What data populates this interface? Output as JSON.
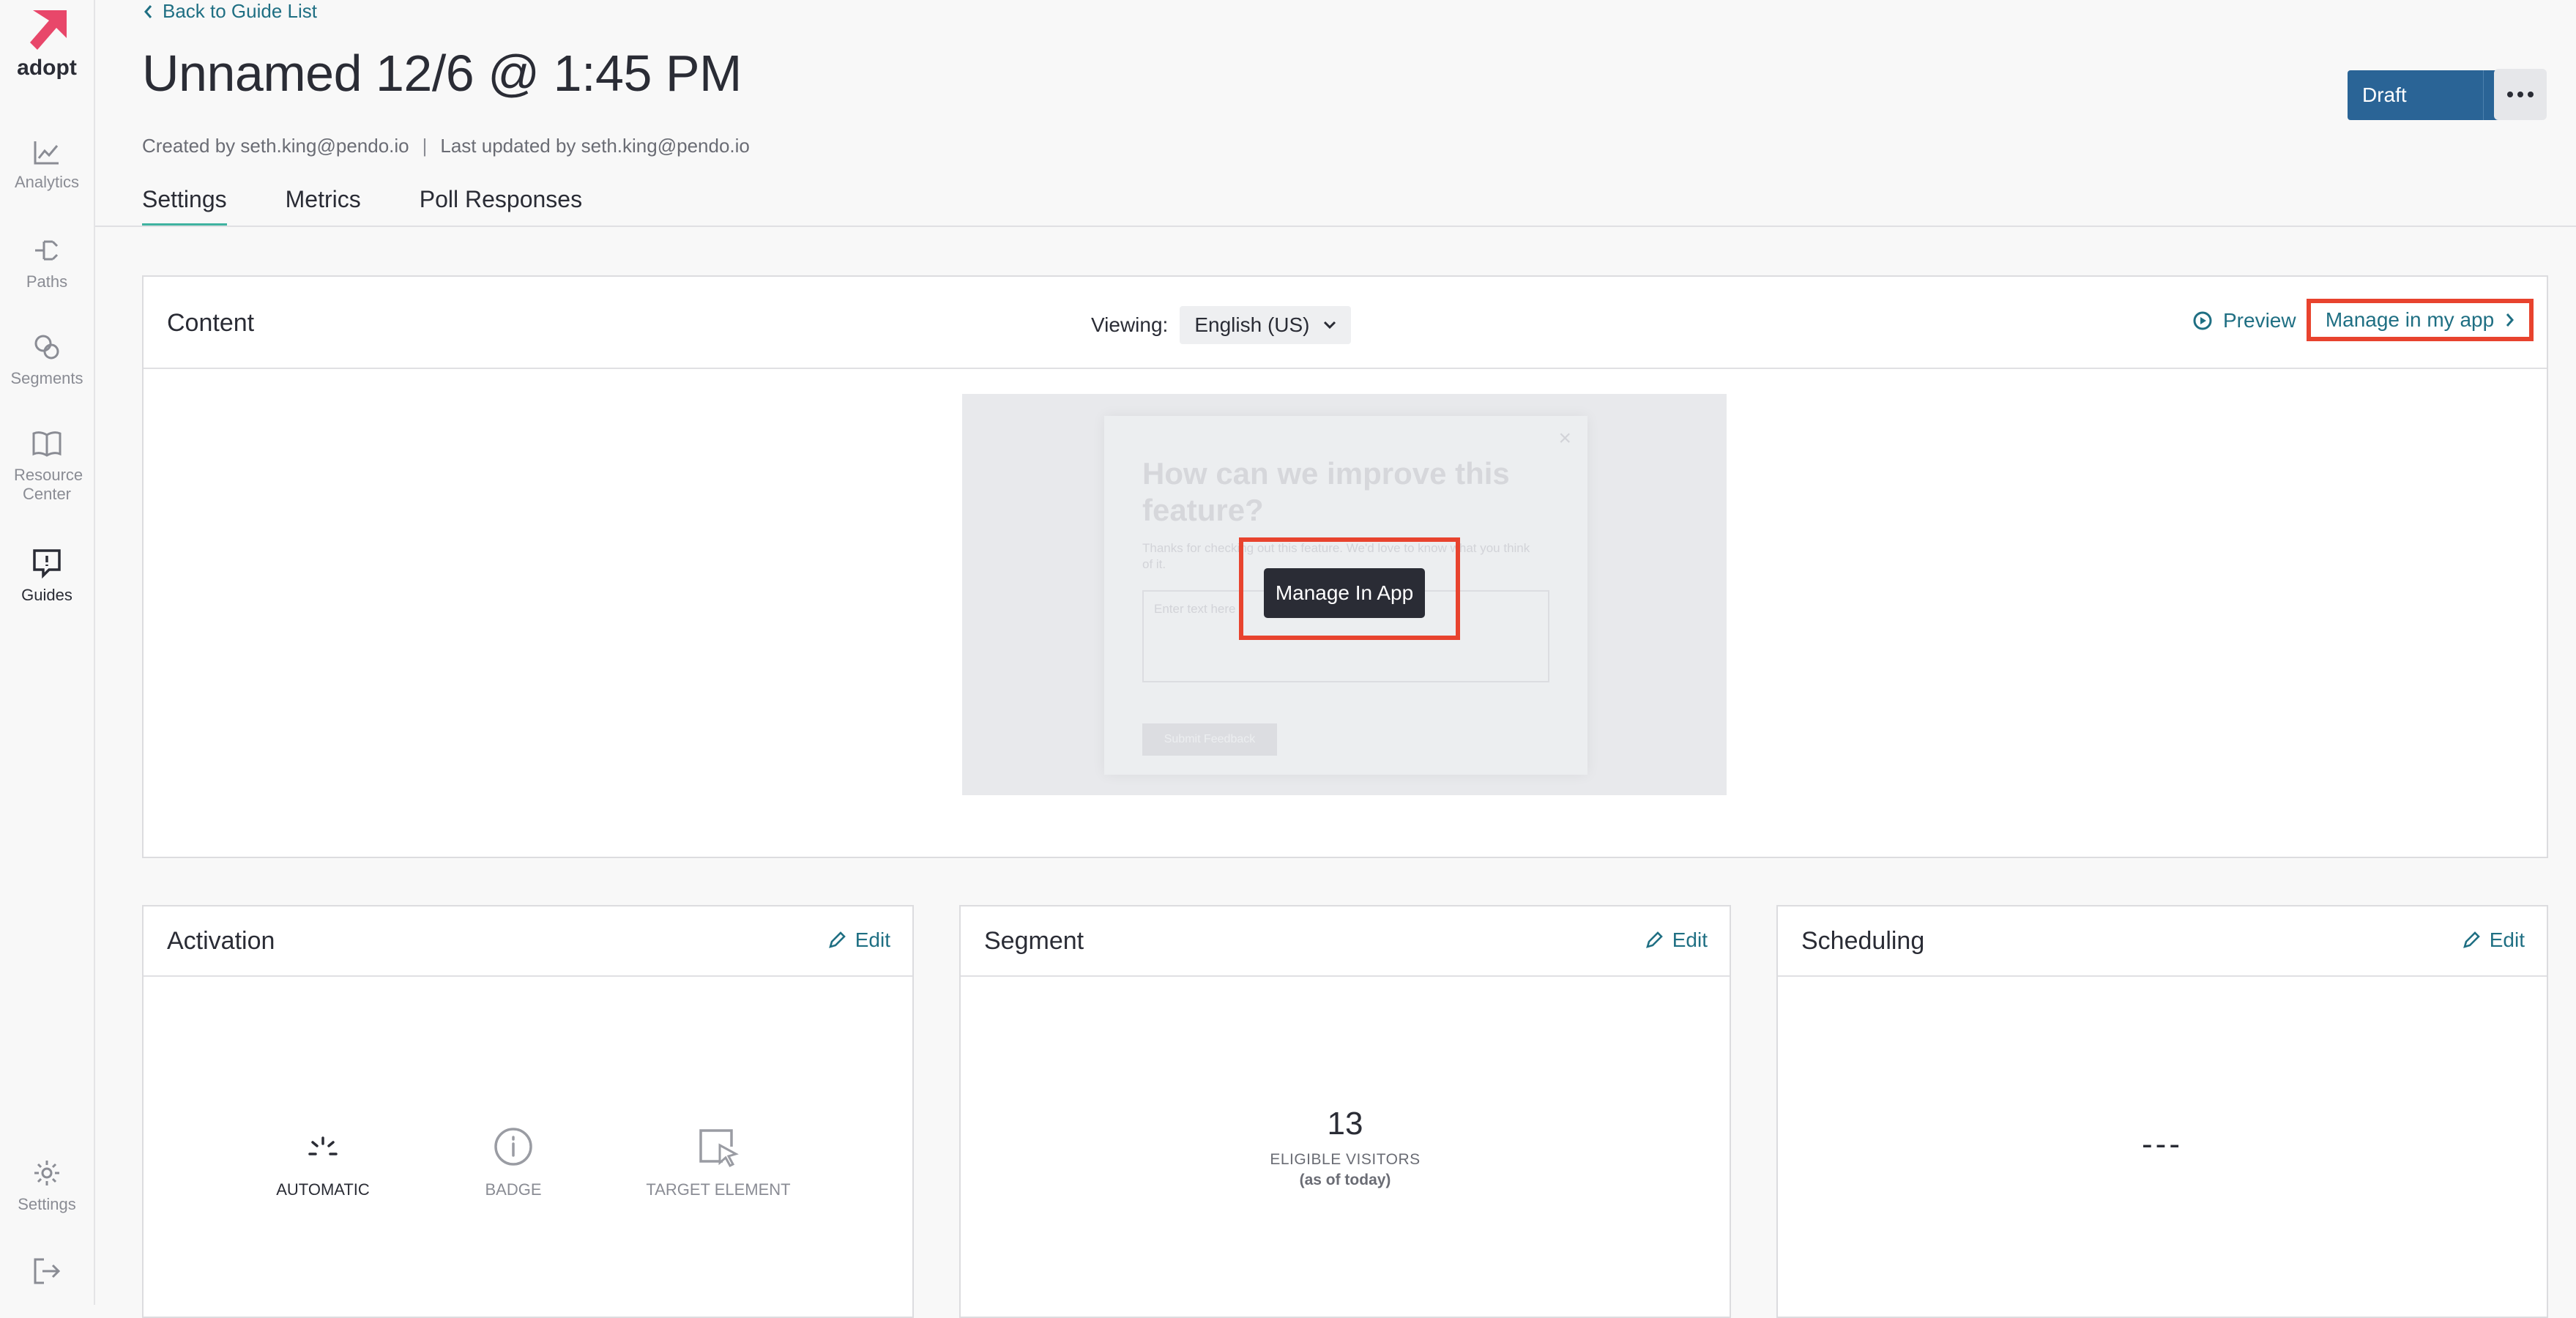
{
  "brand": {
    "name": "adopt",
    "accent": "#e8476a"
  },
  "sidebar": {
    "items": [
      {
        "label": "Analytics",
        "icon": "chart-icon"
      },
      {
        "label": "Paths",
        "icon": "paths-icon"
      },
      {
        "label": "Segments",
        "icon": "segments-icon"
      },
      {
        "label": "Resource Center",
        "icon": "book-icon"
      },
      {
        "label": "Guides",
        "icon": "guides-icon"
      }
    ],
    "bottom": [
      {
        "label": "Settings",
        "icon": "gear-icon"
      },
      {
        "label": "",
        "icon": "logout-icon"
      }
    ]
  },
  "header": {
    "back_label": "Back to Guide List",
    "title": "Unnamed 12/6 @ 1:45 PM",
    "created_by": "Created by seth.king@pendo.io",
    "updated_by": "Last updated by seth.king@pendo.io",
    "status_label": "Draft"
  },
  "tabs": [
    {
      "label": "Settings",
      "active": true
    },
    {
      "label": "Metrics",
      "active": false
    },
    {
      "label": "Poll Responses",
      "active": false
    }
  ],
  "content": {
    "title": "Content",
    "viewing_label": "Viewing:",
    "language": "English (US)",
    "preview_label": "Preview",
    "manage_link_label": "Manage in my app",
    "guide_preview": {
      "title": "How can we improve this feature?",
      "body": "Thanks for checking out this feature. We'd love to know what you think of it.",
      "input_placeholder": "Enter text here",
      "submit_label": "Submit Feedback"
    },
    "manage_button_label": "Manage In App"
  },
  "activation": {
    "title": "Activation",
    "edit_label": "Edit",
    "options": [
      {
        "label": "AUTOMATIC",
        "selected": true
      },
      {
        "label": "BADGE",
        "selected": false
      },
      {
        "label": "TARGET ELEMENT",
        "selected": false
      }
    ]
  },
  "segment": {
    "title": "Segment",
    "edit_label": "Edit",
    "count": "13",
    "count_label": "ELIGIBLE VISITORS",
    "count_sub": "(as of today)"
  },
  "scheduling": {
    "title": "Scheduling",
    "edit_label": "Edit",
    "value": "---"
  },
  "colors": {
    "link": "#1f6f83",
    "primary_button": "#2a6496",
    "highlight": "#e8432e",
    "tab_underline": "#3fb2a0"
  }
}
